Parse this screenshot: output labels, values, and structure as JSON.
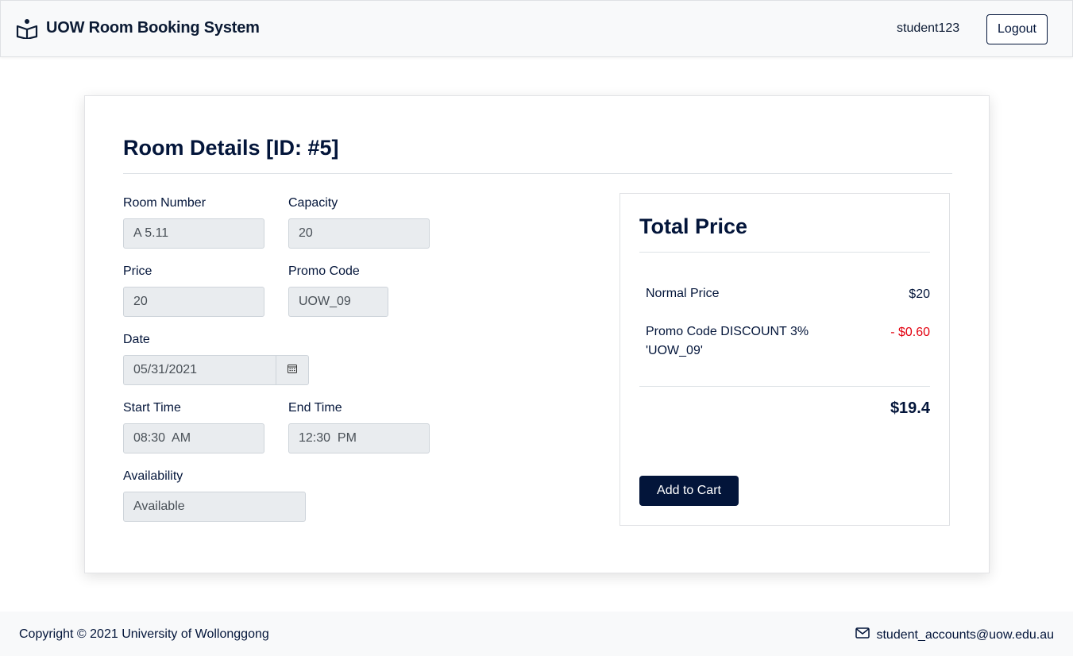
{
  "header": {
    "brand_icon": "open-book-icon",
    "brand_title": "UOW Room Booking System",
    "username": "student123",
    "logout_label": "Logout"
  },
  "room": {
    "title": "Room Details [ID: #5]",
    "room_number_label": "Room Number",
    "room_number_value": "A 5.11",
    "capacity_label": "Capacity",
    "capacity_value": "20",
    "price_label": "Price",
    "price_value": "20",
    "promo_label": "Promo Code",
    "promo_value": "UOW_09",
    "date_label": "Date",
    "date_value": "05/31/2021",
    "calendar_icon": "calendar-icon",
    "start_time_label": "Start Time",
    "start_time_value": "08:30  AM",
    "end_time_label": "End Time",
    "end_time_value": "12:30  PM",
    "availability_label": "Availability",
    "availability_value": "Available"
  },
  "pricing": {
    "title": "Total Price",
    "normal_label": "Normal Price",
    "normal_value": "$20",
    "discount_label_line1": "Promo Code DISCOUNT 3%",
    "discount_label_line2": "'UOW_09'",
    "discount_value": "- $0.60",
    "total_value": "$19.4",
    "cart_label": "Add to Cart"
  },
  "footer": {
    "copyright": "Copyright © 2021 University of Wollonggong",
    "mail_icon": "envelope-icon",
    "email": "student_accounts@uow.edu.au"
  },
  "colors": {
    "navy": "#03153a",
    "discount_red": "#e3000f",
    "input_bg": "#e9ecef"
  }
}
